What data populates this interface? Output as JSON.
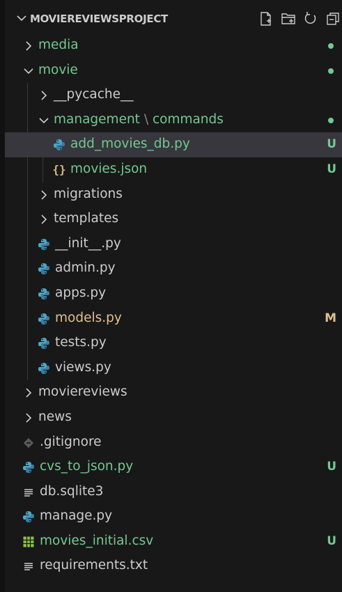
{
  "explorer": {
    "project_title": "MOVIEREVIEWSPROJECT",
    "actions": [
      "new-file-icon",
      "new-folder-icon",
      "refresh-icon",
      "collapse-all-icon"
    ]
  },
  "colors": {
    "background": "#181818",
    "selected": "#37373d",
    "untracked": "#73c991",
    "modified": "#e2c08d",
    "text": "#cccccc",
    "python": "#4ea5c8",
    "json": "#d7ba7d",
    "csv": "#8bc34a"
  },
  "tree": {
    "rows": [
      {
        "label": "media",
        "kind": "folder",
        "depth": 0,
        "state": "collapsed",
        "color": "green",
        "decoration": "dot"
      },
      {
        "label": "movie",
        "kind": "folder",
        "depth": 0,
        "state": "expanded",
        "color": "green",
        "decoration": "dot"
      },
      {
        "label": "__pycache__",
        "kind": "folder",
        "depth": 1,
        "state": "collapsed",
        "color": "default",
        "decoration": ""
      },
      {
        "label": "management",
        "label2": "commands",
        "kind": "folder",
        "depth": 1,
        "state": "expanded",
        "color": "green",
        "decoration": "dot"
      },
      {
        "label": "add_movies_db.py",
        "kind": "python",
        "depth": 2,
        "color": "green",
        "decoration": "U",
        "selected": true
      },
      {
        "label": "movies.json",
        "kind": "json",
        "depth": 2,
        "color": "green",
        "decoration": "U"
      },
      {
        "label": "migrations",
        "kind": "folder",
        "depth": 1,
        "state": "collapsed",
        "color": "default",
        "decoration": ""
      },
      {
        "label": "templates",
        "kind": "folder",
        "depth": 1,
        "state": "collapsed",
        "color": "default",
        "decoration": ""
      },
      {
        "label": "__init__.py",
        "kind": "python",
        "depth": 1,
        "color": "default",
        "decoration": ""
      },
      {
        "label": "admin.py",
        "kind": "python",
        "depth": 1,
        "color": "default",
        "decoration": ""
      },
      {
        "label": "apps.py",
        "kind": "python",
        "depth": 1,
        "color": "default",
        "decoration": ""
      },
      {
        "label": "models.py",
        "kind": "python",
        "depth": 1,
        "color": "yellow",
        "decoration": "M"
      },
      {
        "label": "tests.py",
        "kind": "python",
        "depth": 1,
        "color": "default",
        "decoration": ""
      },
      {
        "label": "views.py",
        "kind": "python",
        "depth": 1,
        "color": "default",
        "decoration": ""
      },
      {
        "label": "moviereviews",
        "kind": "folder",
        "depth": 0,
        "state": "collapsed",
        "color": "default",
        "decoration": ""
      },
      {
        "label": "news",
        "kind": "folder",
        "depth": 0,
        "state": "collapsed",
        "color": "default",
        "decoration": ""
      },
      {
        "label": ".gitignore",
        "kind": "git",
        "depth": 0,
        "color": "default",
        "decoration": ""
      },
      {
        "label": "cvs_to_json.py",
        "kind": "python",
        "depth": 0,
        "color": "green",
        "decoration": "U"
      },
      {
        "label": "db.sqlite3",
        "kind": "text",
        "depth": 0,
        "color": "default",
        "decoration": ""
      },
      {
        "label": "manage.py",
        "kind": "python",
        "depth": 0,
        "color": "default",
        "decoration": ""
      },
      {
        "label": "movies_initial.csv",
        "kind": "csv",
        "depth": 0,
        "color": "green",
        "decoration": "U"
      },
      {
        "label": "requirements.txt",
        "kind": "text",
        "depth": 0,
        "color": "default",
        "decoration": ""
      }
    ]
  }
}
